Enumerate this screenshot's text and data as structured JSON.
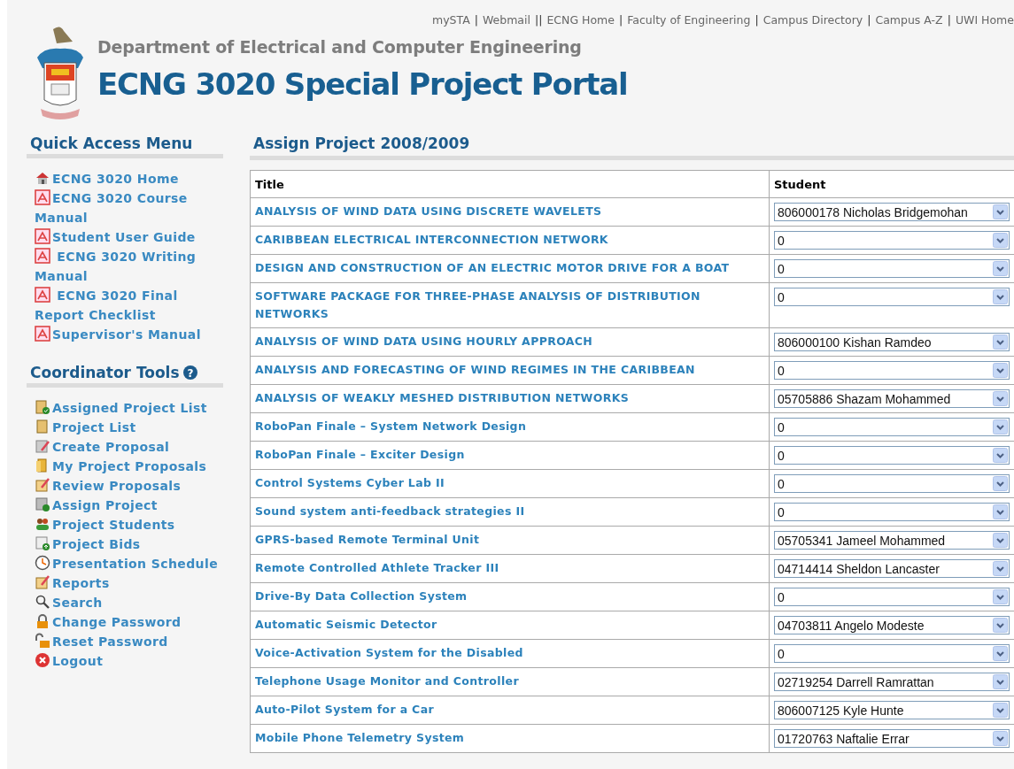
{
  "top_links": [
    {
      "label": "mySTA",
      "separator_after": "|"
    },
    {
      "label": "Webmail",
      "separator_after": "||"
    },
    {
      "label": "ECNG Home",
      "separator_after": "|"
    },
    {
      "label": "Faculty of Engineering",
      "separator_after": "|"
    },
    {
      "label": "Campus Directory",
      "separator_after": "|"
    },
    {
      "label": "Campus A-Z",
      "separator_after": "|"
    },
    {
      "label": "UWI Home"
    }
  ],
  "header": {
    "department": "Department of Electrical and Computer Engineering",
    "title": "ECNG 3020 Special Project Portal"
  },
  "quick_access": {
    "heading": "Quick Access Menu",
    "items": [
      {
        "kind": "home",
        "label": "ECNG 3020 Home"
      },
      {
        "kind": "pdf",
        "label": "ECNG 3020 Course Manual"
      },
      {
        "kind": "pdf",
        "label": "Student User Guide"
      },
      {
        "kind": "pdf",
        "label": " ECNG 3020 Writing Manual"
      },
      {
        "kind": "pdf",
        "label": " ECNG 3020 Final Report Checklist"
      },
      {
        "kind": "pdf",
        "label": "Supervisor's Manual"
      }
    ]
  },
  "coordinator_tools": {
    "heading": "Coordinator Tools",
    "help_mark": "?",
    "items": [
      {
        "kind": "clipboard-check",
        "label": "Assigned Project List"
      },
      {
        "kind": "clipboard",
        "label": "Project List"
      },
      {
        "kind": "page-pencil",
        "label": "Create Proposal"
      },
      {
        "kind": "folder",
        "label": "My Project Proposals"
      },
      {
        "kind": "note-pencil",
        "label": "Review Proposals"
      },
      {
        "kind": "page-check",
        "label": "Assign Project"
      },
      {
        "kind": "people",
        "label": "Project Students"
      },
      {
        "kind": "page-up",
        "label": "Project Bids"
      },
      {
        "kind": "clock",
        "label": "Presentation Schedule"
      },
      {
        "kind": "note-pencil",
        "label": "Reports"
      },
      {
        "kind": "search",
        "label": "Search"
      },
      {
        "kind": "lock",
        "label": "Change Password"
      },
      {
        "kind": "unlock",
        "label": "Reset Password"
      },
      {
        "kind": "logout",
        "label": "Logout"
      }
    ]
  },
  "main": {
    "heading": "Assign Project 2008/2009",
    "table": {
      "columns": [
        "Title",
        "Student"
      ],
      "rows": [
        {
          "title": "ANALYSIS OF WIND DATA USING DISCRETE WAVELETS",
          "student": "806000178 Nicholas Bridgemohan"
        },
        {
          "title": "CARIBBEAN ELECTRICAL INTERCONNECTION NETWORK",
          "student": "0"
        },
        {
          "title": "DESIGN AND CONSTRUCTION OF AN ELECTRIC MOTOR DRIVE FOR A BOAT",
          "student": "0"
        },
        {
          "title": "SOFTWARE PACKAGE FOR THREE-PHASE ANALYSIS OF DISTRIBUTION NETWORKS",
          "student": "0"
        },
        {
          "title": "ANALYSIS OF WIND DATA USING HOURLY APPROACH",
          "student": "806000100 Kishan Ramdeo"
        },
        {
          "title": "ANALYSIS AND FORECASTING OF WIND REGIMES IN THE CARIBBEAN",
          "student": "0"
        },
        {
          "title": "ANALYSIS OF WEAKLY MESHED DISTRIBUTION NETWORKS",
          "student": "05705886 Shazam Mohammed"
        },
        {
          "title": "RoboPan Finale – System Network Design",
          "student": "0"
        },
        {
          "title": "RoboPan Finale – Exciter Design",
          "student": "0"
        },
        {
          "title": "Control Systems Cyber Lab II",
          "student": "0"
        },
        {
          "title": "Sound system anti-feedback strategies II",
          "student": "0"
        },
        {
          "title": "GPRS-based Remote Terminal Unit",
          "student": "05705341 Jameel Mohammed"
        },
        {
          "title": "Remote Controlled Athlete Tracker III",
          "student": "04714414 Sheldon Lancaster"
        },
        {
          "title": "Drive-By Data Collection System",
          "student": "0"
        },
        {
          "title": "Automatic Seismic Detector",
          "student": "04703811 Angelo Modeste"
        },
        {
          "title": "Voice-Activation System for the Disabled",
          "student": "0"
        },
        {
          "title": "Telephone Usage Monitor and Controller",
          "student": "02719254 Darrell Ramrattan"
        },
        {
          "title": "Auto-Pilot System for a Car",
          "student": "806007125 Kyle Hunte"
        },
        {
          "title": "Mobile Phone Telemetry System",
          "student": "01720763 Naftalie Errar"
        }
      ]
    }
  }
}
